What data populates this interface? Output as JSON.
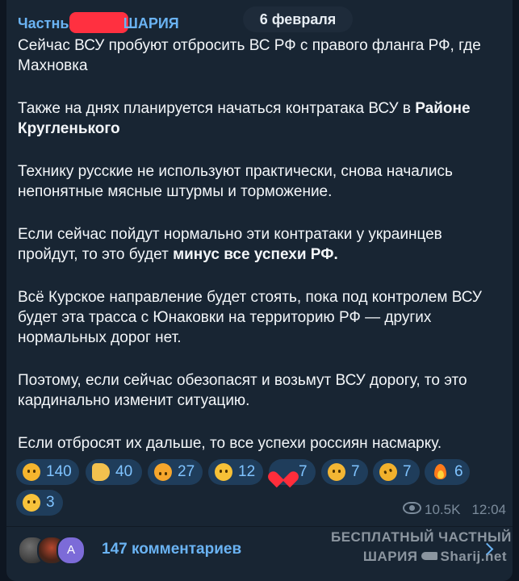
{
  "date_chip": "6 февраля",
  "channel": {
    "name_visible_start": "Частны",
    "name_visible_end": "ШАРИЯ"
  },
  "post": {
    "p1": "Сейчас ВСУ пробуют отбросить ВС РФ с правого фланга РФ, где Махновка",
    "p2_text": "Также на днях планируется начаться контратака ВСУ в",
    "p2_bold": "Районе Кругленького",
    "p3": "Технику русские не используют практически, снова начались непонятные мясные штурмы и торможение.",
    "p4_text": "Если сейчас пойдут нормально эти контратаки у украинцев пройдут, то это будет",
    "p4_bold": "минус все  успехи РФ.",
    "p5": "Всё Курское направление будет стоять, пока под контролем ВСУ будет эта трасса с Юнаковки на территорию РФ — других нормальных дорог нет.",
    "p6": "Поэтому, если сейчас обезопасят и возьмут ВСУ дорогу, то это кардинально изменит ситуацию.",
    "p7": "Если отбросят их дальше, то все успехи россиян насмарку."
  },
  "reactions": [
    {
      "emoji": "thinking-face",
      "count": "140"
    },
    {
      "emoji": "thumbs-up",
      "count": "40"
    },
    {
      "emoji": "exploding-head",
      "count": "27"
    },
    {
      "emoji": "grinning-face",
      "count": "12"
    },
    {
      "emoji": "red-heart",
      "count": "7"
    },
    {
      "emoji": "yawning-face",
      "count": "7"
    },
    {
      "emoji": "rofl-face",
      "count": "7"
    },
    {
      "emoji": "fire",
      "count": "6"
    },
    {
      "emoji": "crying-face",
      "count": "3"
    }
  ],
  "meta": {
    "views": "10.5K",
    "time": "12:04"
  },
  "comments": {
    "label": "147 комментариев",
    "avatar_letter": "A"
  },
  "watermark": {
    "line1": "БЕСПЛАТНЫЙ ЧАСТНЫЙ",
    "line2_left": "ШАРИЯ",
    "line2_right": "Sharij.net"
  },
  "colors": {
    "background": "#0e1621",
    "bubble": "#182533",
    "accent": "#6ab3f3",
    "reaction_bg": "#1f3d5b",
    "meta": "#7b8b9b",
    "redaction": "#ff3040"
  }
}
